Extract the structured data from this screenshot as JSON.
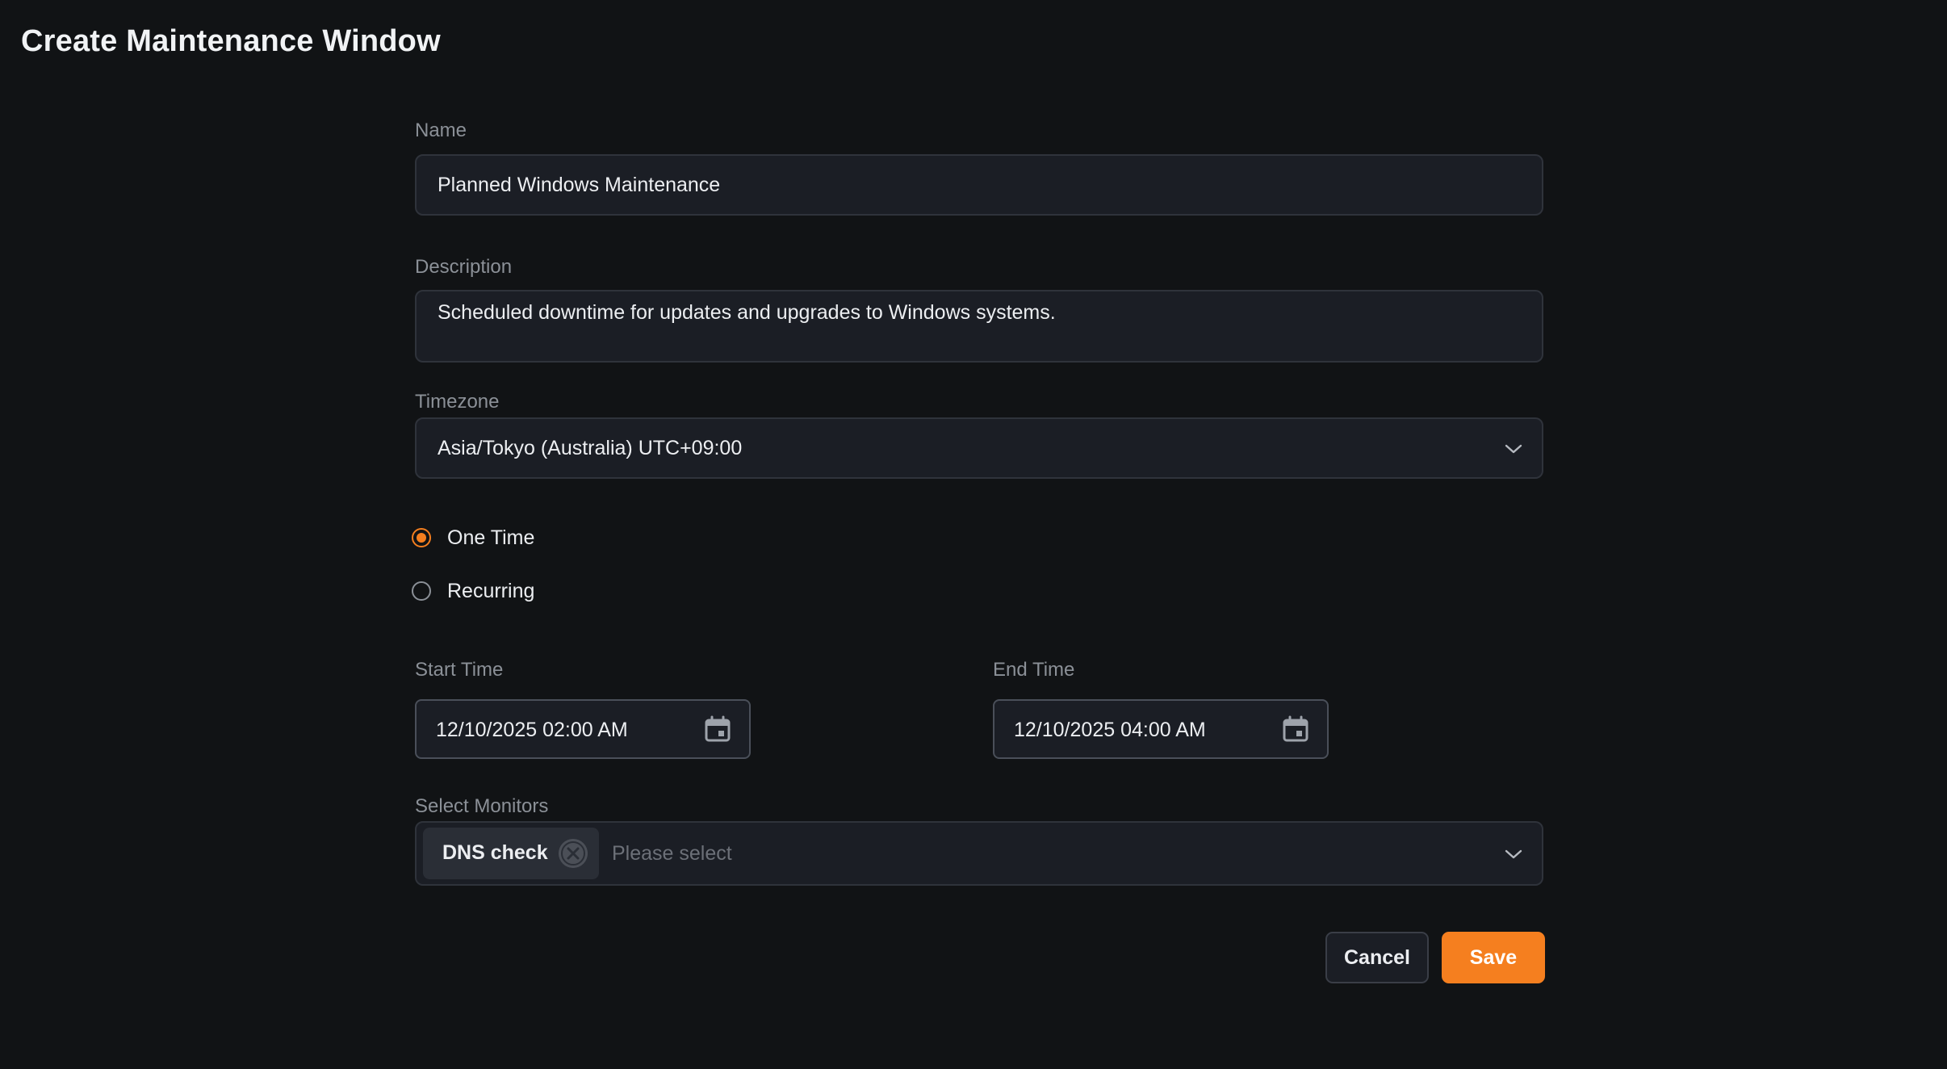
{
  "page": {
    "title": "Create Maintenance Window"
  },
  "name_field": {
    "label": "Name",
    "value": "Planned Windows Maintenance"
  },
  "description_field": {
    "label": "Description",
    "value": "Scheduled downtime for updates and upgrades to Windows systems."
  },
  "timezone_field": {
    "label": "Timezone",
    "value": "Asia/Tokyo (Australia) UTC+09:00",
    "icon": "chevron-down-icon"
  },
  "schedule_type": {
    "options": [
      {
        "label": "One Time",
        "checked": true
      },
      {
        "label": "Recurring",
        "checked": false
      }
    ]
  },
  "start_time": {
    "label": "Start Time",
    "value": "12/10/2025 02:00 AM",
    "icon": "calendar-icon"
  },
  "end_time": {
    "label": "End Time",
    "value": "12/10/2025 04:00 AM",
    "icon": "calendar-icon"
  },
  "monitors_field": {
    "label": "Select Monitors",
    "selected": [
      "DNS check"
    ],
    "placeholder": "Please select",
    "icon": "chevron-down-icon"
  },
  "actions": {
    "cancel_label": "Cancel",
    "save_label": "Save"
  },
  "colors": {
    "background": "#111315",
    "field_bg": "#1b1e25",
    "accent": "#f57f1f",
    "muted_text": "#8b9097"
  }
}
